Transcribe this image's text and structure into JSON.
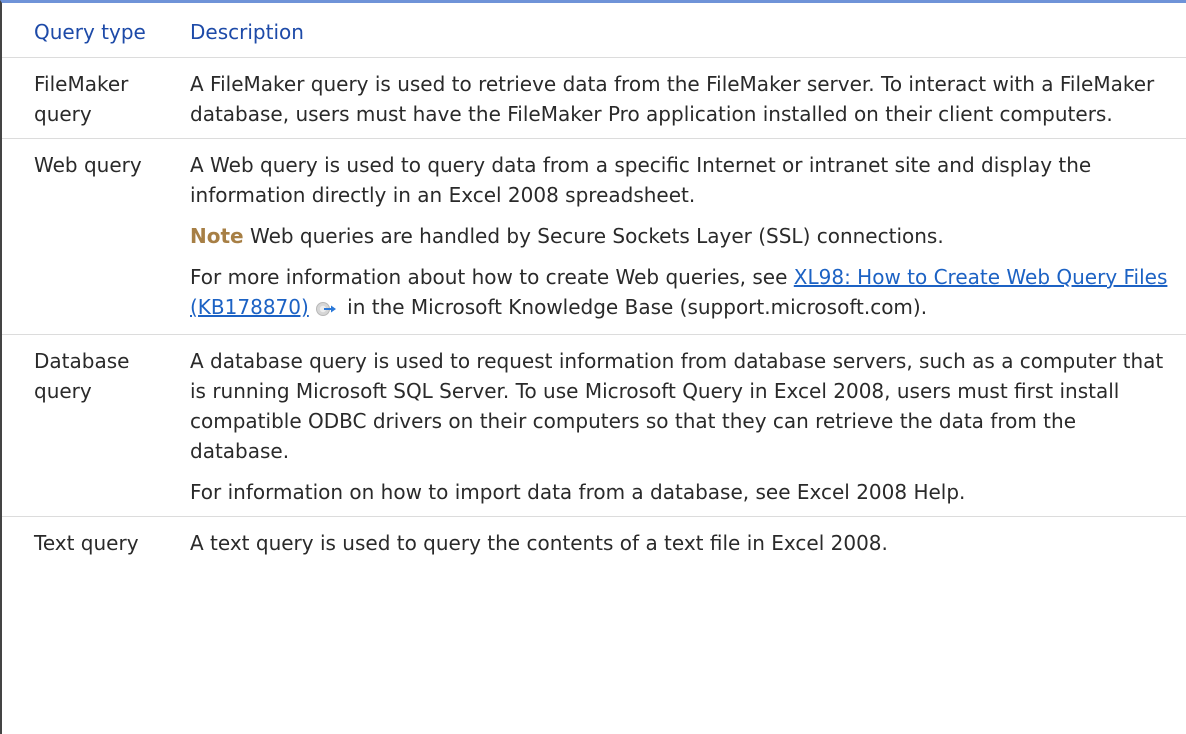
{
  "table": {
    "headers": {
      "query_type": "Query type",
      "description": "Description"
    },
    "rows": [
      {
        "type": "FileMaker query",
        "description": "A FileMaker query is used to retrieve data from the FileMaker server. To interact with a FileMaker database, users must have the FileMaker Pro application installed on their client computers."
      },
      {
        "type": "Web query",
        "description": "A Web query is used to query data from a specific Internet or intranet site and display the information directly in an Excel 2008 spreadsheet.",
        "note_label": "Note",
        "note_text": " Web queries are handled by Secure Sockets Layer (SSL) connections.",
        "more_prefix": "For more information about how to create Web queries, see ",
        "link_text": "XL98: How to Create Web Query Files (KB178870)",
        "more_suffix": " in the Microsoft Knowledge Base (support.microsoft.com)."
      },
      {
        "type": "Database query",
        "description": "A database query is used to request information from database servers, such as a computer that is running Microsoft SQL Server. To use Microsoft Query in Excel 2008, users must first install compatible ODBC drivers on their computers so that they can retrieve the data from the database.",
        "extra": "For information on how to import data from a database, see Excel 2008 Help."
      },
      {
        "type": "Text query",
        "description": "A text query is used to query the contents of a text file in Excel 2008."
      }
    ]
  },
  "icons": {
    "external_link": "external-link-icon"
  },
  "colors": {
    "header_text": "#1d4aa8",
    "link": "#1c62c4",
    "note_label": "#a77f45",
    "top_rule": "#6f93d8"
  }
}
